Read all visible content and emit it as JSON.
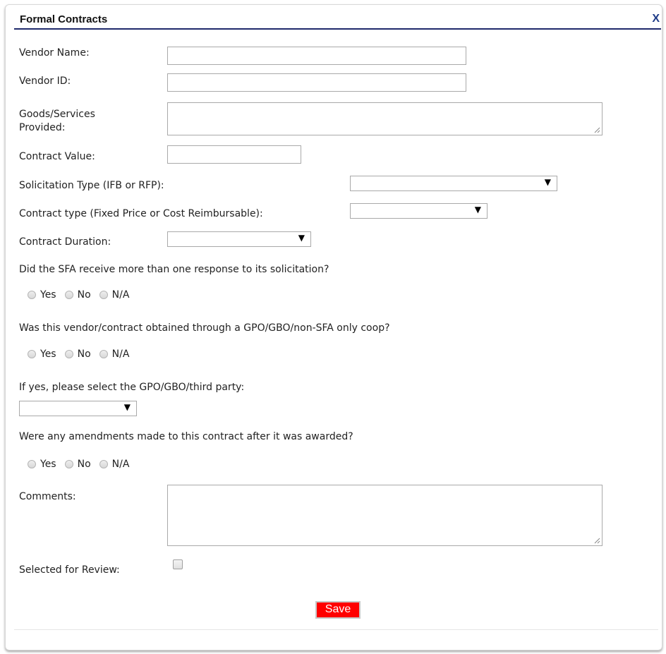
{
  "dialog": {
    "title": "Formal Contracts",
    "close_label": "X"
  },
  "fields": {
    "vendor_name": {
      "label": "Vendor Name:",
      "value": ""
    },
    "vendor_id": {
      "label": "Vendor ID:",
      "value": ""
    },
    "goods_services_line1": "Goods/Services",
    "goods_services_line2": "Provided:",
    "contract_value": {
      "label": "Contract Value:",
      "value": ""
    },
    "solicitation_type": {
      "label": "Solicitation Type (IFB or RFP):",
      "selected": ""
    },
    "contract_type": {
      "label": "Contract type (Fixed Price or Cost Reimbursable):",
      "selected": ""
    },
    "contract_duration": {
      "label": "Contract Duration:",
      "selected": ""
    }
  },
  "questions": {
    "q1": "Did the SFA receive more than one response to its solicitation?",
    "q2": "Was this vendor/contract obtained through a GPO/GBO/non-SFA only coop?",
    "q3": "If yes, please select the GPO/GBO/third party:",
    "q4": "Were any amendments made to this contract after it was awarded?"
  },
  "radio_options": {
    "yes": "Yes",
    "no": "No",
    "na": "N/A"
  },
  "comments_label": "Comments:",
  "selected_for_review_label": "Selected for Review:",
  "save_label": "Save",
  "dropdown_arrow": "▼"
}
